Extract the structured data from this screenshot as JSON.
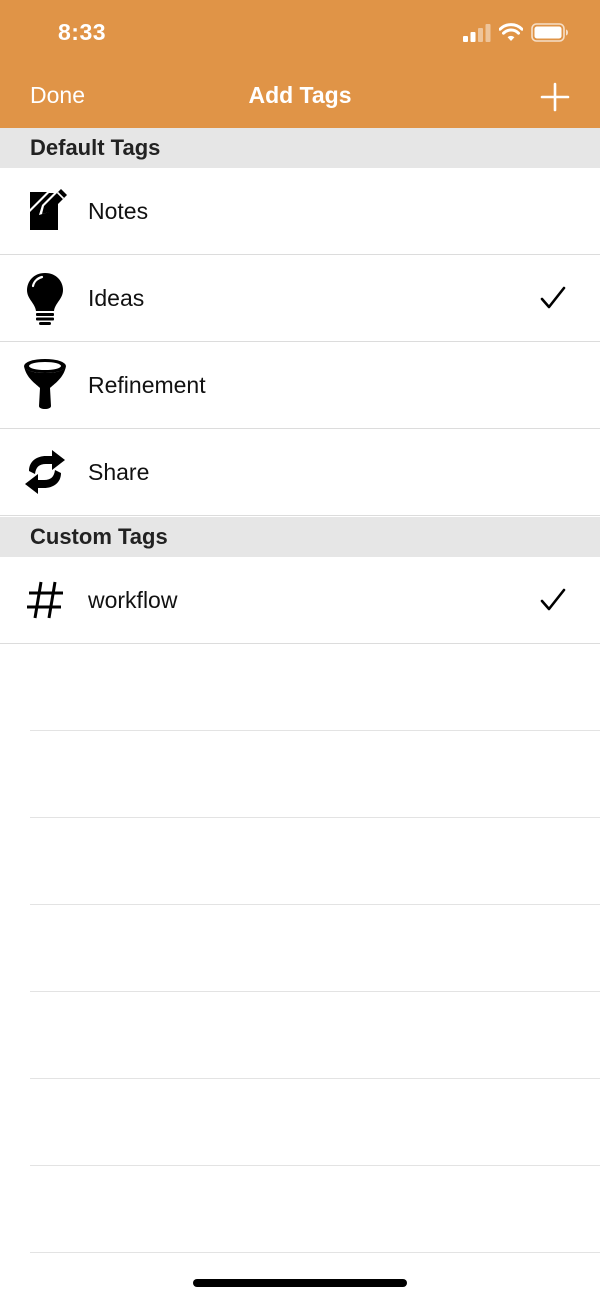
{
  "status_bar": {
    "time": "8:33"
  },
  "nav": {
    "left": "Done",
    "title": "Add Tags",
    "right_icon": "plus-icon"
  },
  "colors": {
    "accent": "#E09447",
    "section_bg": "#E6E6E6"
  },
  "sections": [
    {
      "title": "Default Tags",
      "items": [
        {
          "label": "Notes",
          "icon": "note-pencil-icon",
          "checked": false
        },
        {
          "label": "Ideas",
          "icon": "lightbulb-icon",
          "checked": true
        },
        {
          "label": "Refinement",
          "icon": "funnel-icon",
          "checked": false
        },
        {
          "label": "Share",
          "icon": "share-arrows-icon",
          "checked": false
        }
      ]
    },
    {
      "title": "Custom Tags",
      "items": [
        {
          "label": "workflow",
          "icon": "hashtag-icon",
          "checked": true
        }
      ]
    }
  ]
}
